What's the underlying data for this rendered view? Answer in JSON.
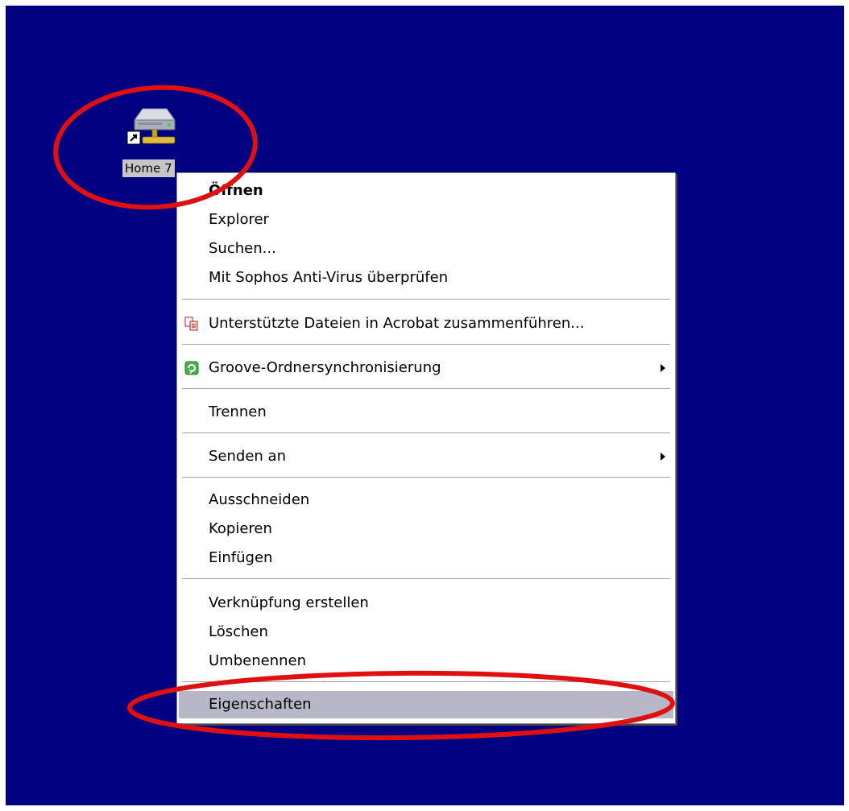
{
  "desktop": {
    "background_color": "#000080",
    "icon": {
      "name": "network-drive-icon",
      "label": "Home 7"
    }
  },
  "context_menu": {
    "items": [
      {
        "label": "Öffnen",
        "bold": true
      },
      {
        "label": "Explorer"
      },
      {
        "label": "Suchen..."
      },
      {
        "label": "Mit Sophos Anti-Virus überprüfen"
      },
      {
        "label": "Unterstützte Dateien in Acrobat zusammenführen...",
        "icon": "acrobat-combine-icon"
      },
      {
        "label": "Groove-Ordnersynchronisierung",
        "icon": "groove-sync-icon",
        "submenu": true
      },
      {
        "label": "Trennen"
      },
      {
        "label": "Senden an",
        "submenu": true
      },
      {
        "label": "Ausschneiden"
      },
      {
        "label": "Kopieren"
      },
      {
        "label": "Einfügen"
      },
      {
        "label": "Verknüpfung erstellen"
      },
      {
        "label": "Löschen"
      },
      {
        "label": "Umbenennen"
      },
      {
        "label": "Eigenschaften",
        "highlighted": true
      }
    ]
  },
  "annotations": {
    "color": "#e01010",
    "shape": "ellipse",
    "targets": [
      "desktop-icon",
      "menu-item-properties"
    ]
  }
}
